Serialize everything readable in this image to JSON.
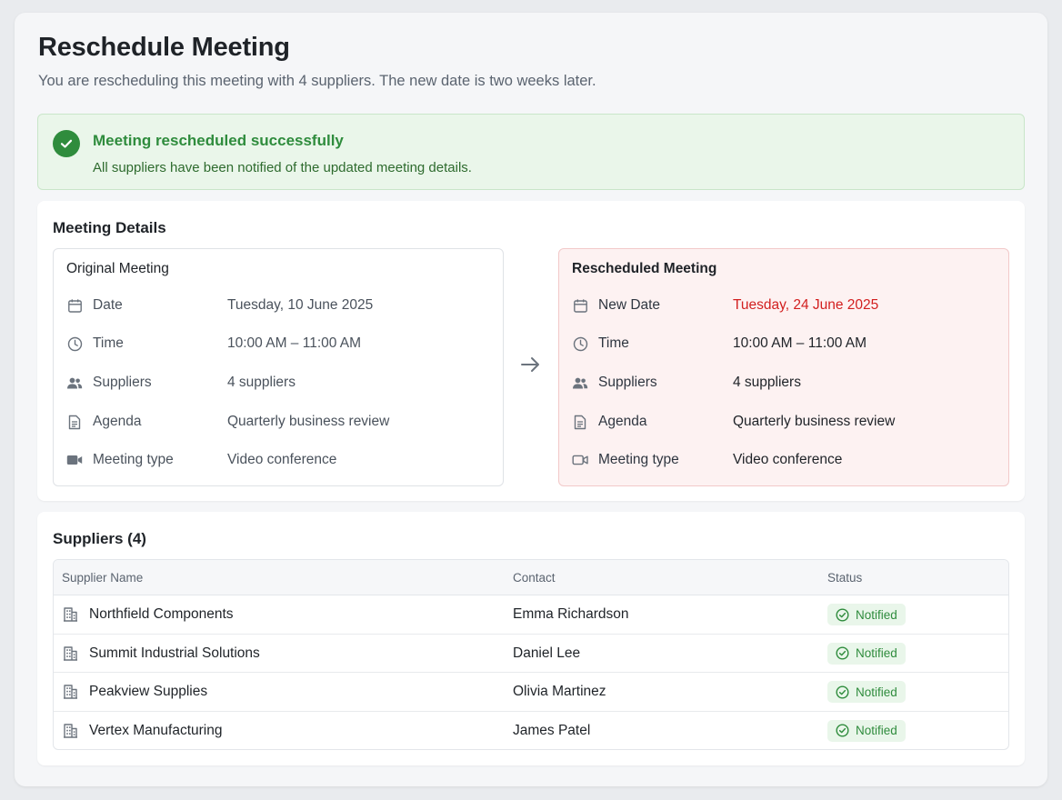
{
  "page": {
    "title": "Reschedule Meeting",
    "subtitle": "You are rescheduling this meeting with 4 suppliers. The new date is two weeks later."
  },
  "banner": {
    "icon": "check-circle-icon",
    "title": "Meeting rescheduled successfully",
    "text": "All suppliers have been notified of the updated meeting details."
  },
  "details": {
    "title": "Meeting Details",
    "original": {
      "heading": "Original Meeting",
      "rows": [
        {
          "icon": "calendar-icon",
          "label": "Date",
          "value": "Tuesday, 10 June 2025"
        },
        {
          "icon": "clock-icon",
          "label": "Time",
          "value": "10:00 AM – 11:00 AM"
        },
        {
          "icon": "users-icon",
          "label": "Suppliers",
          "value": "4 suppliers"
        },
        {
          "icon": "document-icon",
          "label": "Agenda",
          "value": "Quarterly business review"
        },
        {
          "icon": "video-icon",
          "label": "Meeting type",
          "value": "Video conference"
        }
      ]
    },
    "rescheduled": {
      "heading": "Rescheduled Meeting",
      "rows": [
        {
          "icon": "calendar-icon",
          "label": "New Date",
          "value": "Tuesday, 24 June 2025"
        },
        {
          "icon": "clock-icon",
          "label": "Time",
          "value": "10:00 AM – 11:00 AM"
        },
        {
          "icon": "users-icon",
          "label": "Suppliers",
          "value": "4 suppliers"
        },
        {
          "icon": "document-icon",
          "label": "Agenda",
          "value": "Quarterly business review"
        },
        {
          "icon": "video-icon",
          "label": "Meeting type",
          "value": "Video conference"
        }
      ]
    }
  },
  "suppliers": {
    "title": "Suppliers (4)",
    "columns": [
      "Supplier Name",
      "Contact",
      "Status"
    ],
    "rows": [
      {
        "name": "Northfield Components",
        "contact": "Emma Richardson",
        "status": "Notified"
      },
      {
        "name": "Summit Industrial Solutions",
        "contact": "Daniel Lee",
        "status": "Notified"
      },
      {
        "name": "Peakview Supplies",
        "contact": "Olivia Martinez",
        "status": "Notified"
      },
      {
        "name": "Vertex Manufacturing",
        "contact": "James Patel",
        "status": "Notified"
      }
    ]
  },
  "colors": {
    "success": "#2f8c3d",
    "highlight": "#d21f1f",
    "banner_bg": "#eaf6ea",
    "rescheduled_bg": "#fdf2f2"
  }
}
